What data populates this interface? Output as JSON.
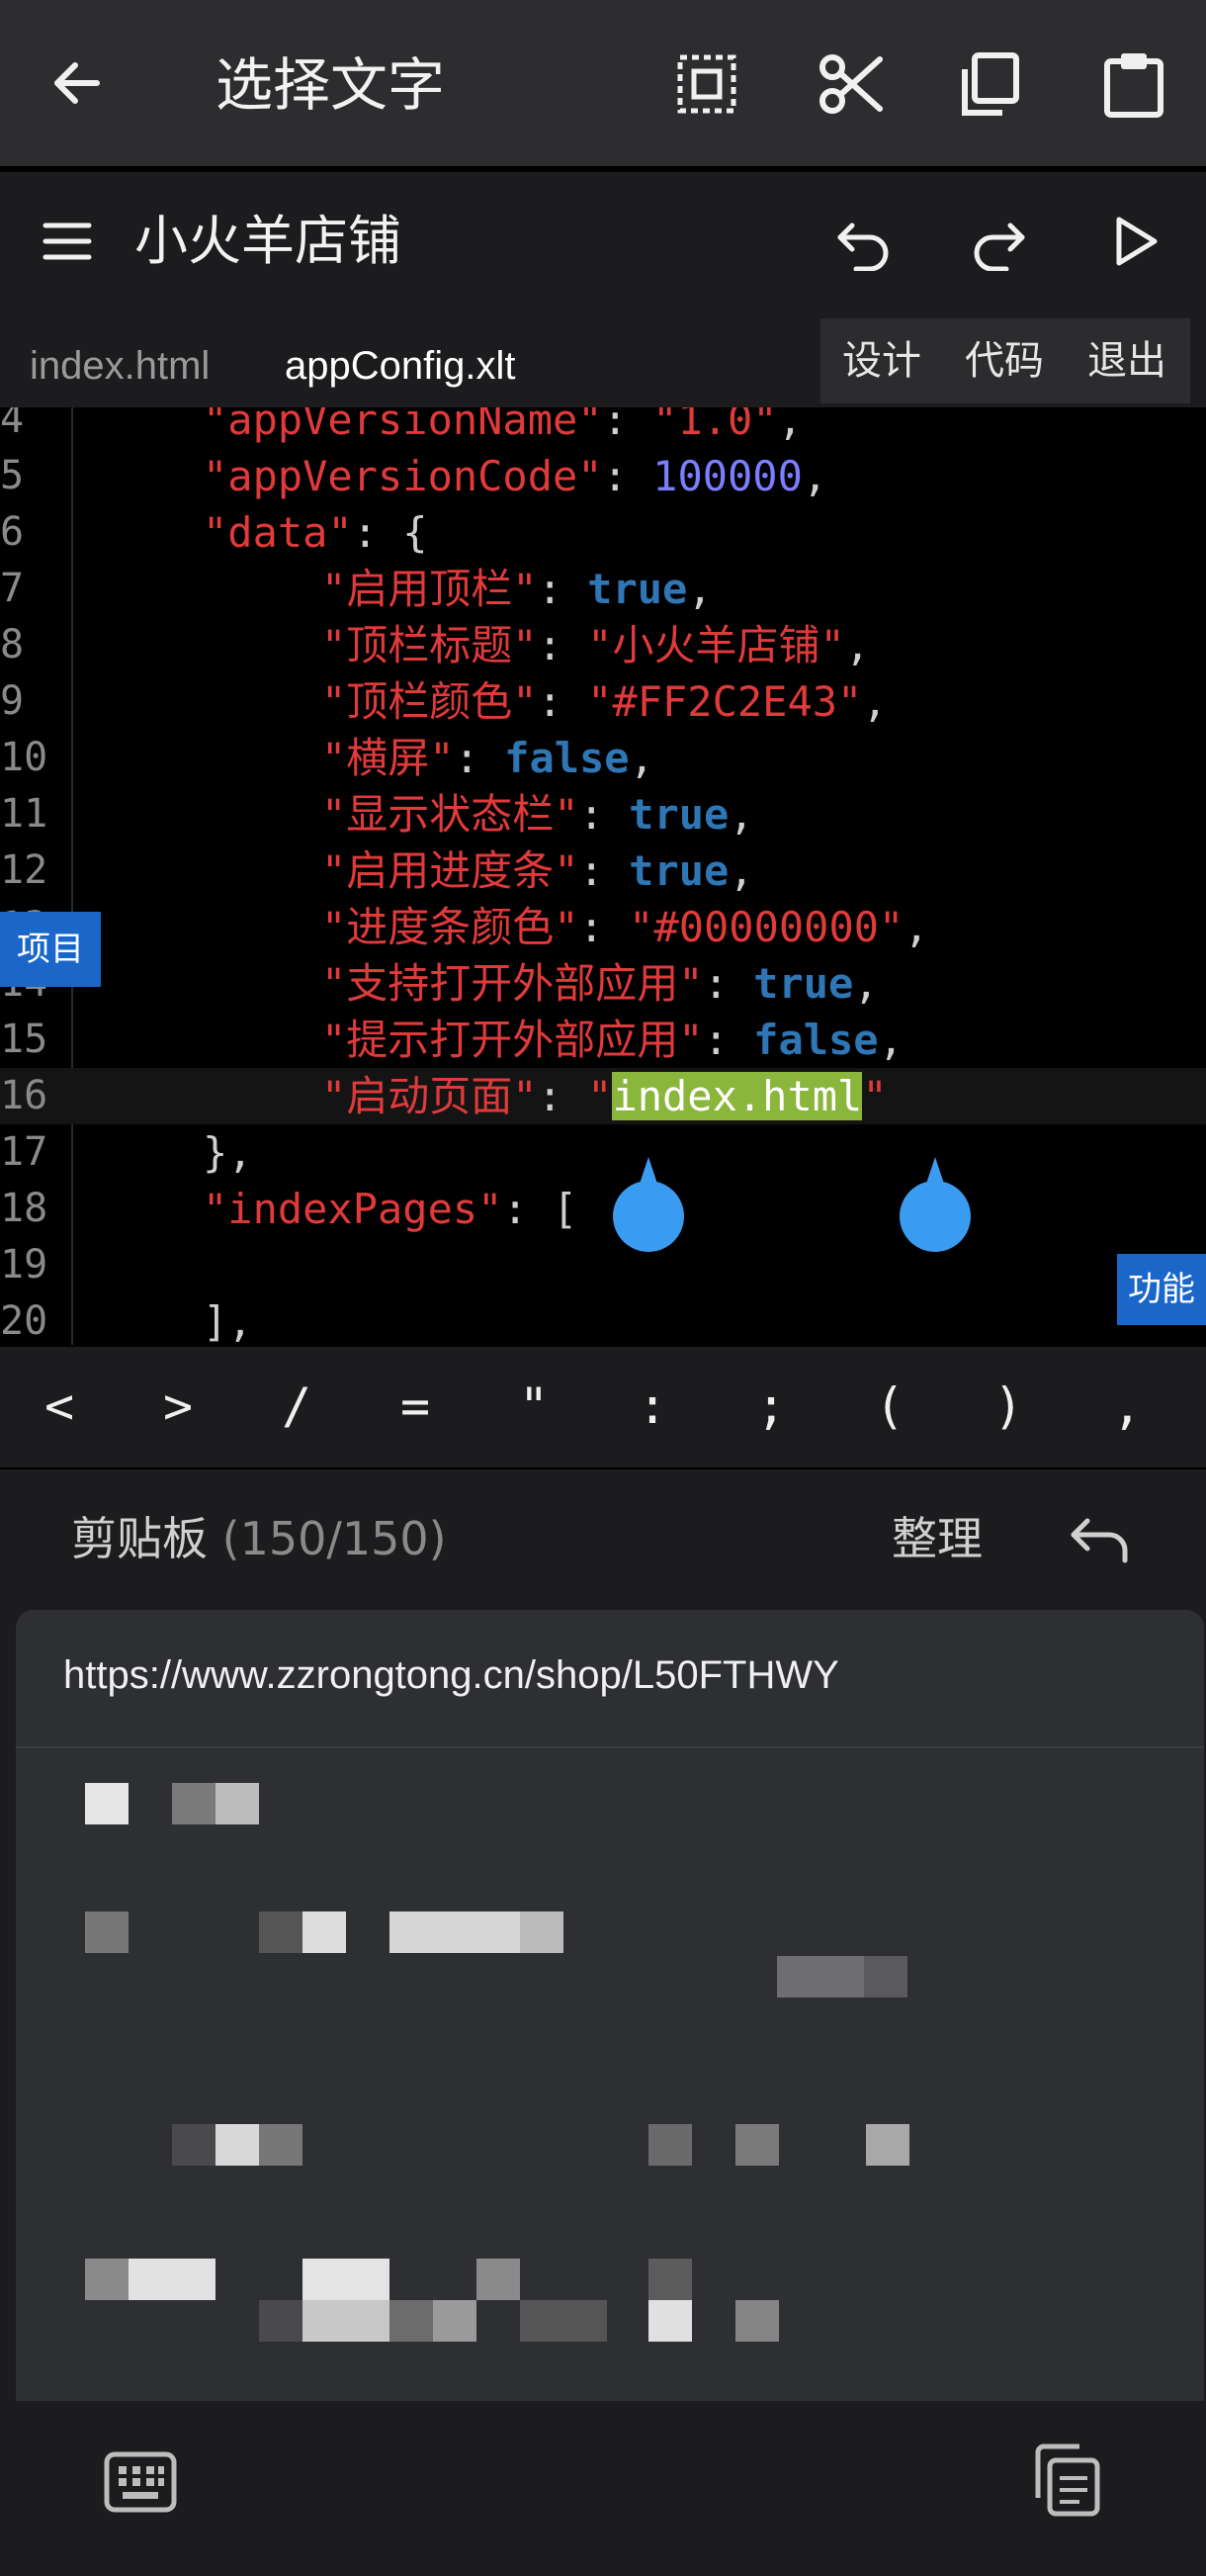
{
  "action_bar": {
    "title": "选择文字",
    "actions": [
      "select-all",
      "cut",
      "copy",
      "paste"
    ]
  },
  "app": {
    "project_title": "小火羊店铺",
    "tabs": [
      {
        "label": "index.html",
        "active": false
      },
      {
        "label": "appConfig.xlt",
        "active": true
      }
    ],
    "modes": [
      "设计",
      "代码",
      "退出"
    ]
  },
  "editor": {
    "lines": [
      {
        "no": "4",
        "indent": 2,
        "tokens": [
          {
            "t": "\"appVersionName\"",
            "c": "k"
          },
          {
            "t": ": ",
            "c": "p"
          },
          {
            "t": "\"1.0\"",
            "c": "k"
          },
          {
            "t": ",",
            "c": "p"
          }
        ]
      },
      {
        "no": "5",
        "indent": 2,
        "tokens": [
          {
            "t": "\"appVersionCode\"",
            "c": "k"
          },
          {
            "t": ": ",
            "c": "p"
          },
          {
            "t": "100000",
            "c": "n"
          },
          {
            "t": ",",
            "c": "p"
          }
        ]
      },
      {
        "no": "6",
        "indent": 2,
        "tokens": [
          {
            "t": "\"data\"",
            "c": "k"
          },
          {
            "t": ": {",
            "c": "p"
          }
        ]
      },
      {
        "no": "7",
        "indent": 4,
        "tokens": [
          {
            "t": "\"启用顶栏\"",
            "c": "k"
          },
          {
            "t": ": ",
            "c": "p"
          },
          {
            "t": "true",
            "c": "b"
          },
          {
            "t": ",",
            "c": "p"
          }
        ]
      },
      {
        "no": "8",
        "indent": 4,
        "tokens": [
          {
            "t": "\"顶栏标题\"",
            "c": "k"
          },
          {
            "t": ": ",
            "c": "p"
          },
          {
            "t": "\"小火羊店铺\"",
            "c": "k"
          },
          {
            "t": ",",
            "c": "p"
          }
        ]
      },
      {
        "no": "9",
        "indent": 4,
        "tokens": [
          {
            "t": "\"顶栏颜色\"",
            "c": "k"
          },
          {
            "t": ": ",
            "c": "p"
          },
          {
            "t": "\"#FF2C2E43\"",
            "c": "k"
          },
          {
            "t": ",",
            "c": "p"
          }
        ]
      },
      {
        "no": "10",
        "indent": 4,
        "tokens": [
          {
            "t": "\"横屏\"",
            "c": "k"
          },
          {
            "t": ": ",
            "c": "p"
          },
          {
            "t": "false",
            "c": "b"
          },
          {
            "t": ",",
            "c": "p"
          }
        ]
      },
      {
        "no": "11",
        "indent": 4,
        "tokens": [
          {
            "t": "\"显示状态栏\"",
            "c": "k"
          },
          {
            "t": ": ",
            "c": "p"
          },
          {
            "t": "true",
            "c": "b"
          },
          {
            "t": ",",
            "c": "p"
          }
        ]
      },
      {
        "no": "12",
        "indent": 4,
        "tokens": [
          {
            "t": "\"启用进度条\"",
            "c": "k"
          },
          {
            "t": ": ",
            "c": "p"
          },
          {
            "t": "true",
            "c": "b"
          },
          {
            "t": ",",
            "c": "p"
          }
        ]
      },
      {
        "no": "13",
        "indent": 4,
        "tokens": [
          {
            "t": "\"进度条颜色\"",
            "c": "k"
          },
          {
            "t": ": ",
            "c": "p"
          },
          {
            "t": "\"#00000000\"",
            "c": "k"
          },
          {
            "t": ",",
            "c": "p"
          }
        ]
      },
      {
        "no": "14",
        "indent": 4,
        "tokens": [
          {
            "t": "\"支持打开外部应用\"",
            "c": "k"
          },
          {
            "t": ": ",
            "c": "p"
          },
          {
            "t": "true",
            "c": "b"
          },
          {
            "t": ",",
            "c": "p"
          }
        ]
      },
      {
        "no": "15",
        "indent": 4,
        "tokens": [
          {
            "t": "\"提示打开外部应用\"",
            "c": "k"
          },
          {
            "t": ": ",
            "c": "p"
          },
          {
            "t": "false",
            "c": "b"
          },
          {
            "t": ",",
            "c": "p"
          }
        ]
      },
      {
        "no": "16",
        "indent": 4,
        "current": true,
        "tokens": [
          {
            "t": "\"启动页面\"",
            "c": "k"
          },
          {
            "t": ": ",
            "c": "p"
          },
          {
            "t": "\"",
            "c": "k"
          },
          {
            "t": "index.html",
            "c": "sel"
          },
          {
            "t": "\"",
            "c": "k"
          }
        ]
      },
      {
        "no": "17",
        "indent": 2,
        "tokens": [
          {
            "t": "},",
            "c": "p"
          }
        ]
      },
      {
        "no": "18",
        "indent": 2,
        "tokens": [
          {
            "t": "\"indexPages\"",
            "c": "k"
          },
          {
            "t": ": [",
            "c": "p"
          }
        ]
      },
      {
        "no": "19",
        "indent": 0,
        "tokens": []
      },
      {
        "no": "20",
        "indent": 2,
        "tokens": [
          {
            "t": "],",
            "c": "p"
          }
        ]
      }
    ],
    "side_tabs": {
      "left": "项目",
      "right": "功能"
    }
  },
  "symbols": [
    "<",
    ">",
    "/",
    "=",
    "\"",
    ":",
    ";",
    "(",
    ")",
    ","
  ],
  "clipboard": {
    "title": "剪贴板",
    "count": "(150/150)",
    "tidy_label": "整理",
    "first_item": "https://www.zzrongtong.cn/shop/L50FTHWY"
  },
  "colors": {
    "key": "#e03a3a",
    "number": "#7d7dff",
    "boolean": "#2f76b5",
    "selection": "#8ab63b",
    "handle": "#3a9cf0",
    "side_tab": "#1a66c9"
  }
}
